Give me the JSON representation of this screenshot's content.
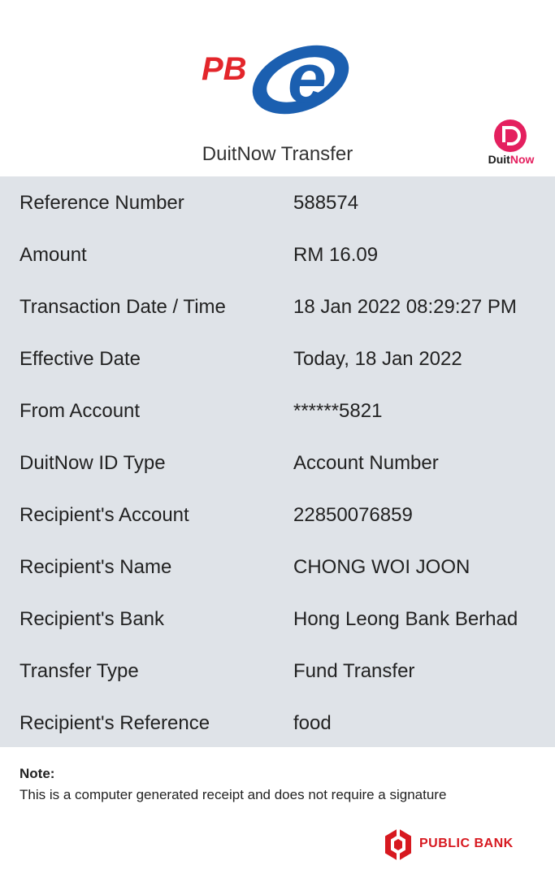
{
  "header": {
    "logo_text": "PB",
    "logo_mark": "e",
    "title": "DuitNow Transfer",
    "duitnow_brand_part1": "Duit",
    "duitnow_brand_part2": "Now"
  },
  "details": [
    {
      "label": "Reference Number",
      "value": "588574"
    },
    {
      "label": "Amount",
      "value": "RM 16.09"
    },
    {
      "label": "Transaction Date / Time",
      "value": "18 Jan 2022 08:29:27 PM"
    },
    {
      "label": "Effective Date",
      "value": "Today, 18 Jan 2022"
    },
    {
      "label": "From Account",
      "value": "******5821"
    },
    {
      "label": "DuitNow ID Type",
      "value": "Account Number"
    },
    {
      "label": "Recipient's Account",
      "value": "22850076859"
    },
    {
      "label": "Recipient's Name",
      "value": "CHONG WOI JOON"
    },
    {
      "label": "Recipient's Bank",
      "value": "Hong Leong Bank Berhad"
    },
    {
      "label": "Transfer Type",
      "value": "Fund Transfer"
    },
    {
      "label": "Recipient's Reference",
      "value": "food"
    }
  ],
  "note": {
    "title": "Note:",
    "text": "This is a computer generated receipt and does not require a signature"
  },
  "footer": {
    "bank_name": "PUBLIC BANK"
  },
  "icons": {
    "pbe_logo": "pbe-logo-icon",
    "duitnow_logo": "duitnow-logo-icon",
    "public_bank_logo": "public-bank-emblem-icon"
  },
  "colors": {
    "brand_red": "#e3262b",
    "brand_blue": "#1b5fb0",
    "duitnow_pink": "#e4205f",
    "details_background": "#dfe3e8"
  }
}
